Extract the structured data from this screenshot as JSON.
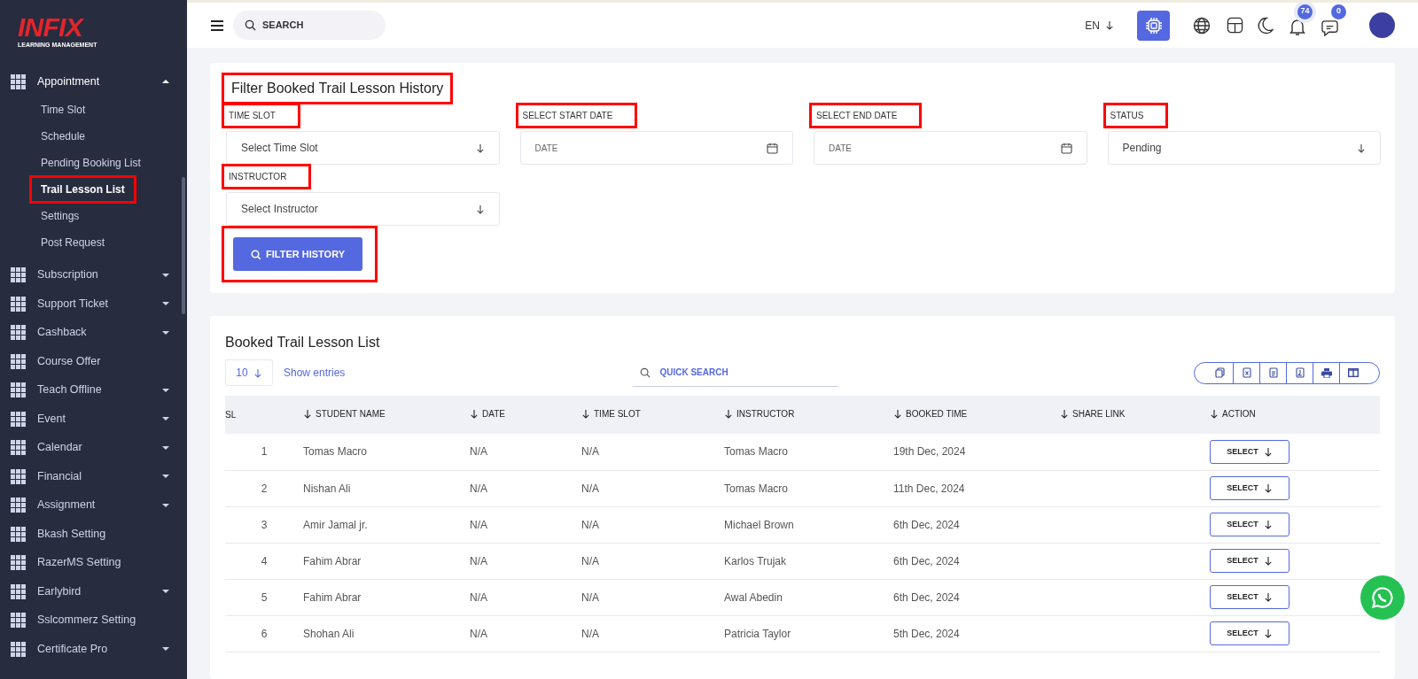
{
  "logo": {
    "brand": "INFIX",
    "tagline": "LEARNING MANAGEMENT"
  },
  "topbar": {
    "search": {
      "placeholder": "SEARCH"
    },
    "language": "EN",
    "notifications": "74",
    "messages": "0"
  },
  "sidebar": {
    "items": [
      {
        "label": "Appointment",
        "expandable": true,
        "expanded": true,
        "children": [
          {
            "label": "Time Slot",
            "selected": false,
            "highlighted": false
          },
          {
            "label": "Schedule",
            "selected": false,
            "highlighted": false
          },
          {
            "label": "Pending Booking List",
            "selected": false,
            "highlighted": false
          },
          {
            "label": "Trail Lesson List",
            "selected": true,
            "highlighted": true
          },
          {
            "label": "Settings",
            "selected": false,
            "highlighted": false
          },
          {
            "label": "Post Request",
            "selected": false,
            "highlighted": false
          }
        ]
      },
      {
        "label": "Subscription",
        "expandable": true,
        "expanded": false
      },
      {
        "label": "Support Ticket",
        "expandable": true,
        "expanded": false
      },
      {
        "label": "Cashback",
        "expandable": true,
        "expanded": false
      },
      {
        "label": "Course Offer",
        "expandable": false,
        "expanded": false
      },
      {
        "label": "Teach Offline",
        "expandable": true,
        "expanded": false
      },
      {
        "label": "Event",
        "expandable": true,
        "expanded": false
      },
      {
        "label": "Calendar",
        "expandable": true,
        "expanded": false
      },
      {
        "label": "Financial",
        "expandable": true,
        "expanded": false
      },
      {
        "label": "Assignment",
        "expandable": true,
        "expanded": false
      },
      {
        "label": "Bkash Setting",
        "expandable": false,
        "expanded": false
      },
      {
        "label": "RazerMS Setting",
        "expandable": false,
        "expanded": false
      },
      {
        "label": "Earlybird",
        "expandable": true,
        "expanded": false
      },
      {
        "label": "Sslcommerz Setting",
        "expandable": false,
        "expanded": false
      },
      {
        "label": "Certificate Pro",
        "expandable": true,
        "expanded": false
      }
    ]
  },
  "filter": {
    "title": "Filter Booked Trail Lesson History",
    "title_highlighted": true,
    "fields": [
      {
        "kind": "select",
        "label": "TIME SLOT",
        "highlighted": true,
        "placeholder": "Select Time Slot"
      },
      {
        "kind": "date",
        "label": "SELECT START DATE",
        "highlighted": true,
        "placeholder": "DATE"
      },
      {
        "kind": "date",
        "label": "SELECT END DATE",
        "highlighted": true,
        "placeholder": "DATE"
      },
      {
        "kind": "select",
        "label": "STATUS",
        "highlighted": true,
        "value": "Pending"
      },
      {
        "kind": "select",
        "label": "INSTRUCTOR",
        "highlighted": true,
        "placeholder": "Select Instructor"
      }
    ],
    "button": {
      "label": "FILTER HISTORY",
      "highlighted": true
    }
  },
  "table": {
    "title": "Booked Trail Lesson List",
    "page_size": "10",
    "show_entries": "Show entries",
    "search": {
      "placeholder": "QUICK SEARCH"
    },
    "columns": [
      {
        "label": "SL",
        "sortable": false
      },
      {
        "label": "STUDENT NAME",
        "sortable": true
      },
      {
        "label": "DATE",
        "sortable": true
      },
      {
        "label": "TIME SLOT",
        "sortable": true
      },
      {
        "label": "INSTRUCTOR",
        "sortable": true
      },
      {
        "label": "BOOKED TIME",
        "sortable": true
      },
      {
        "label": "SHARE LINK",
        "sortable": true
      },
      {
        "label": "ACTION",
        "sortable": true
      }
    ],
    "rows": [
      {
        "sl": "1",
        "student": "Tomas Macro",
        "date": "N/A",
        "time_slot": "N/A",
        "instructor": "Tomas Macro",
        "booked_time": "19th Dec, 2024",
        "action": "SELECT"
      },
      {
        "sl": "2",
        "student": "Nishan Ali",
        "date": "N/A",
        "time_slot": "N/A",
        "instructor": "Tomas Macro",
        "booked_time": "11th Dec, 2024",
        "action": "SELECT"
      },
      {
        "sl": "3",
        "student": "Amir Jamal jr.",
        "date": "N/A",
        "time_slot": "N/A",
        "instructor": "Michael Brown",
        "booked_time": "6th Dec, 2024",
        "action": "SELECT"
      },
      {
        "sl": "4",
        "student": "Fahim Abrar",
        "date": "N/A",
        "time_slot": "N/A",
        "instructor": "Karlos Trujak",
        "booked_time": "6th Dec, 2024",
        "action": "SELECT"
      },
      {
        "sl": "5",
        "student": "Fahim Abrar",
        "date": "N/A",
        "time_slot": "N/A",
        "instructor": "Awal Abedin",
        "booked_time": "6th Dec, 2024",
        "action": "SELECT"
      },
      {
        "sl": "6",
        "student": "Shohan Ali",
        "date": "N/A",
        "time_slot": "N/A",
        "instructor": "Patricia Taylor",
        "booked_time": "5th Dec, 2024",
        "action": "SELECT"
      }
    ]
  }
}
